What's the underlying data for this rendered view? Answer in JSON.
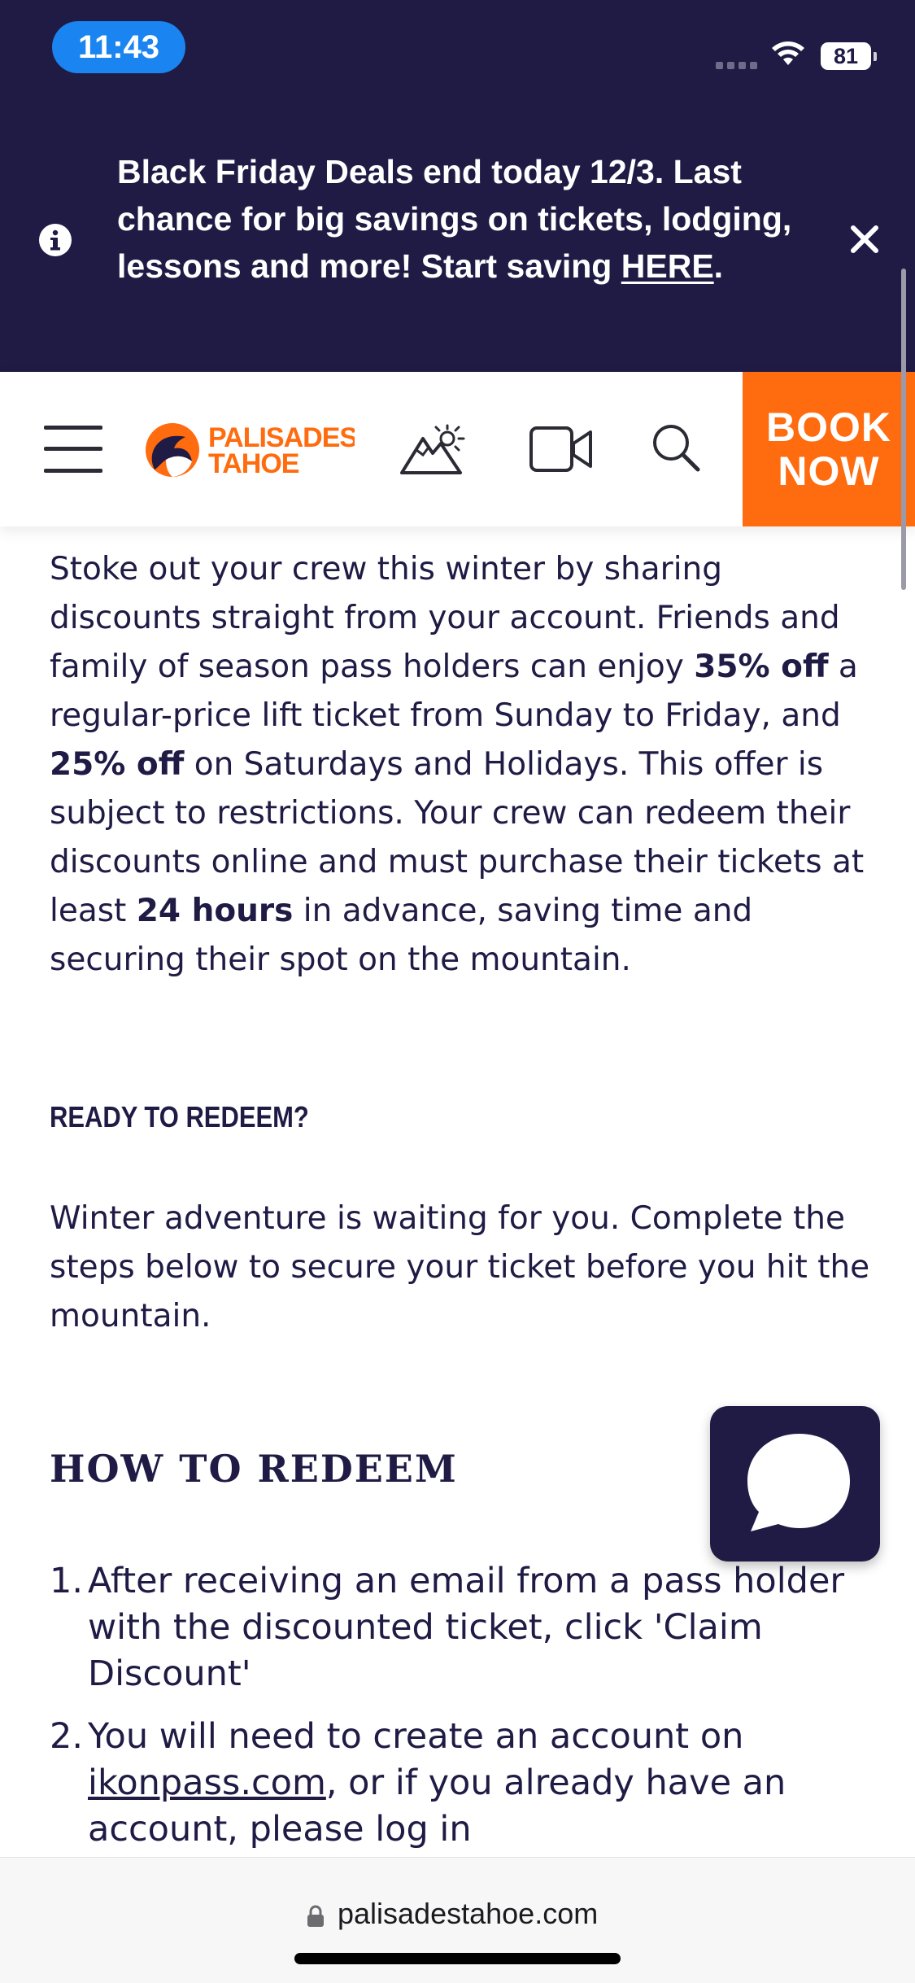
{
  "status_bar": {
    "time": "11:43",
    "battery": "81"
  },
  "promo": {
    "text": "Black Friday Deals end today 12/3. Last chance for big savings on tickets, lodging, lessons and more! Start saving ",
    "link_text": "HERE",
    "suffix": "."
  },
  "nav": {
    "logo_line1": "PALISADES",
    "logo_line2": "TAHOE",
    "book_line1": "BOOK",
    "book_line2": "NOW"
  },
  "content": {
    "intro": {
      "t1": "Stoke out your crew this winter by sharing discounts straight from your account. Friends and family of season pass holders can enjoy ",
      "b1": "35% off",
      "t2": " a regular-price lift ticket from Sunday to Friday, and ",
      "b2": "25% off",
      "t3": " on Saturdays and Holidays. This offer is subject to restrictions. Your crew can redeem their discounts online and must purchase their tickets at least ",
      "b3": "24 hours",
      "t4": " in advance, saving time and securing their spot on the mountain."
    },
    "ready_heading": "READY TO REDEEM?",
    "ready_text": "Winter adventure is waiting for you. Complete the steps below to secure your ticket before you hit the mountain.",
    "how_heading": "HOW TO REDEEM",
    "steps": [
      {
        "num": "1.",
        "text": "After receiving an email from a pass holder with the discounted ticket, click 'Claim Discount'"
      },
      {
        "num": "2.",
        "text_pre": "You will need to create an account on ",
        "link": "ikonpass.com",
        "text_post": ", or if you already have an account, please log in"
      }
    ]
  },
  "url_bar": {
    "domain": "palisadestahoe.com"
  },
  "colors": {
    "navy": "#1f1b45",
    "orange": "#ff6b0f",
    "status_pill": "#1a84f0"
  },
  "icons": [
    "info-icon",
    "close-icon",
    "hamburger-icon",
    "weather-icon",
    "camera-icon",
    "search-icon",
    "chat-icon",
    "lock-icon",
    "wifi-icon"
  ]
}
